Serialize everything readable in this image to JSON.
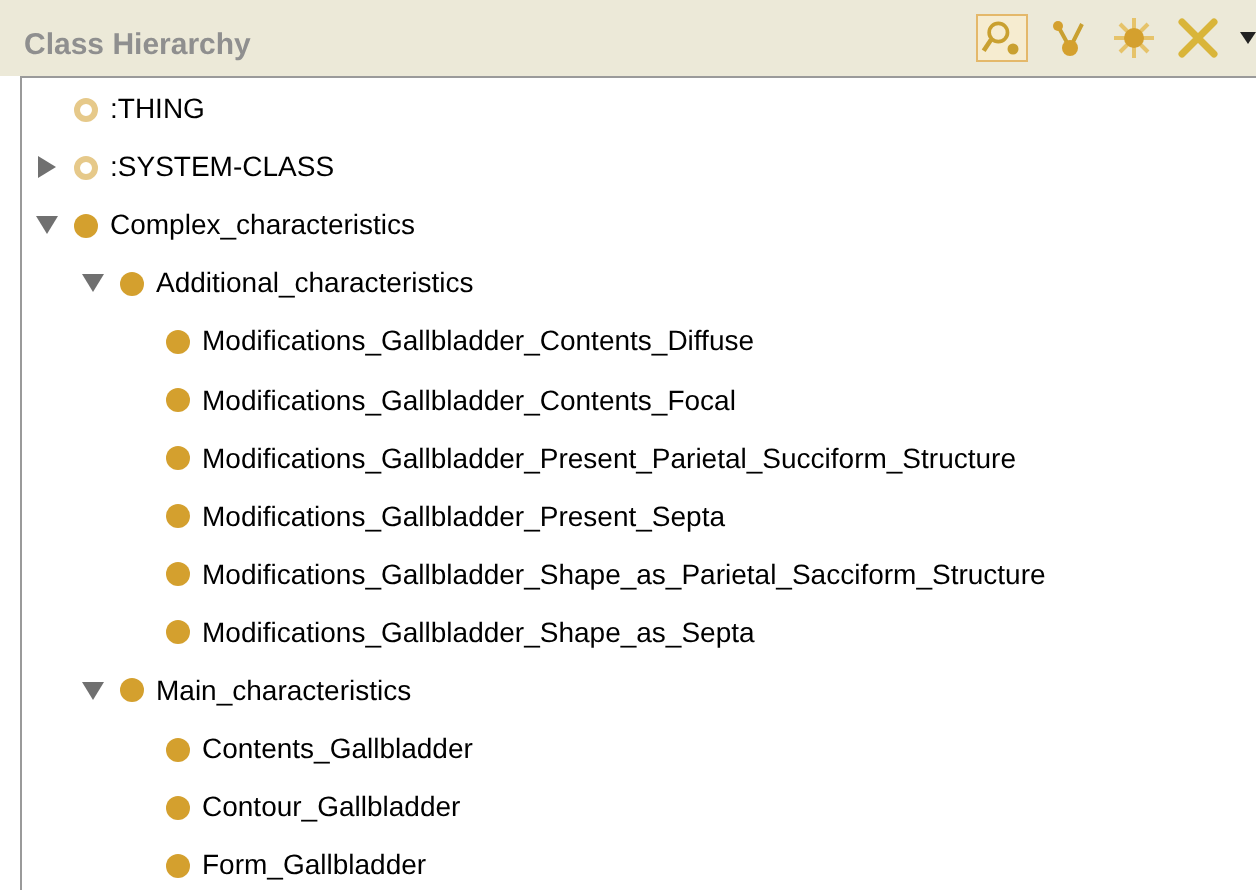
{
  "panel": {
    "title": "Class Hierarchy"
  },
  "tree": [
    {
      "label": ":THING",
      "kind": "system"
    },
    {
      "label": ":SYSTEM-CLASS",
      "kind": "system",
      "expanded": false
    },
    {
      "label": "Complex_characteristics",
      "kind": "class",
      "expanded": true,
      "children": [
        {
          "label": "Additional_characteristics",
          "kind": "class",
          "expanded": true,
          "children": [
            {
              "label": "Modifications_Gallbladder_Contents_Diffuse",
              "kind": "class"
            },
            {
              "label": "Modifications_Gallbladder_Contents_Focal",
              "kind": "class"
            },
            {
              "label": "Modifications_Gallbladder_Present_Parietal_Succiform_Structure",
              "kind": "class"
            },
            {
              "label": "Modifications_Gallbladder_Present_Septa",
              "kind": "class"
            },
            {
              "label": "Modifications_Gallbladder_Shape_as_Parietal_Sacciform_Structure",
              "kind": "class"
            },
            {
              "label": "Modifications_Gallbladder_Shape_as_Septa",
              "kind": "class"
            }
          ]
        },
        {
          "label": "Main_characteristics",
          "kind": "class",
          "expanded": true,
          "children": [
            {
              "label": "Contents_Gallbladder",
              "kind": "class"
            },
            {
              "label": "Contour_Gallbladder",
              "kind": "class"
            },
            {
              "label": "Form_Gallbladder",
              "kind": "class"
            }
          ]
        }
      ]
    }
  ]
}
